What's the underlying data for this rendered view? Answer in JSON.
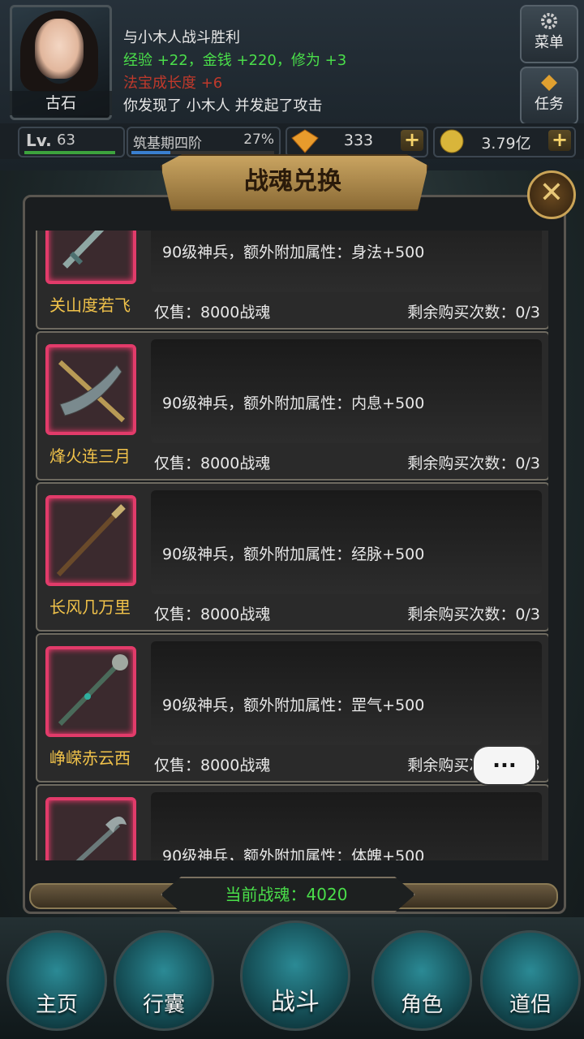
{
  "player": {
    "name": "古石",
    "level_prefix": "Lv.",
    "level": "63",
    "realm": "筑基期四阶",
    "realm_progress": "27%",
    "realm_progress_fraction": 0.27,
    "gems": "333",
    "gold": "3.79亿"
  },
  "log": {
    "line1": "与小木人战斗胜利",
    "line2_exp": "经验 +22",
    "line2_sep1": "，",
    "line2_money": "金钱 +220",
    "line2_sep2": "，",
    "line2_cultivation": "修为 +3",
    "line3": "法宝成长度 +6",
    "line4": "你发现了 小木人 并发起了攻击"
  },
  "top_buttons": {
    "menu": "菜单",
    "task": "任务"
  },
  "panel": {
    "title": "战魂兑换",
    "close_icon": "close-x-icon",
    "current_label": "当前战魂：4020"
  },
  "items": [
    {
      "name": "关山度若飞",
      "desc": "90级神兵，额外附加属性：身法+500",
      "price": "仅售：8000战魂",
      "remain": "剩余购买次数：0/3"
    },
    {
      "name": "烽火连三月",
      "desc": "90级神兵，额外附加属性：内息+500",
      "price": "仅售：8000战魂",
      "remain": "剩余购买次数：0/3"
    },
    {
      "name": "长风几万里",
      "desc": "90级神兵，额外附加属性：经脉+500",
      "price": "仅售：8000战魂",
      "remain": "剩余购买次数：0/3"
    },
    {
      "name": "峥嵘赤云西",
      "desc": "90级神兵，额外附加属性：罡气+500",
      "price": "仅售：8000战魂",
      "remain": "剩余购买次数：0/3"
    },
    {
      "name": "",
      "desc": "90级神兵，额外附加属性：体魄+500",
      "price": "",
      "remain": ""
    }
  ],
  "chat_bubble": "...",
  "nav": [
    "主页",
    "行囊",
    "战斗",
    "角色",
    "道侣"
  ],
  "colors": {
    "accent_green": "#4adf4a",
    "item_name": "#f0c24a",
    "slot_border": "#e23b6a",
    "log_red": "#c0392b"
  }
}
